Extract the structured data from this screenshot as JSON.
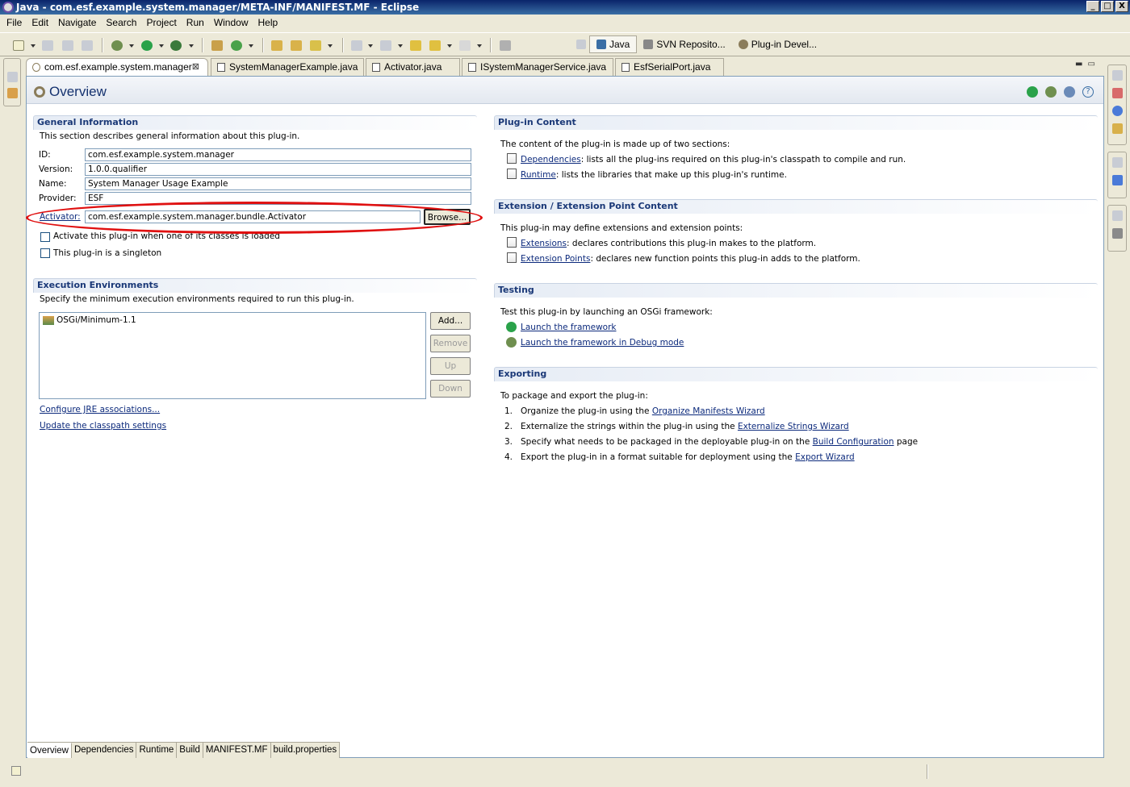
{
  "window": {
    "title": "Java - com.esf.example.system.manager/META-INF/MANIFEST.MF - Eclipse",
    "min": "_",
    "max": "□",
    "close": "X"
  },
  "menu": [
    "File",
    "Edit",
    "Navigate",
    "Search",
    "Project",
    "Run",
    "Window",
    "Help"
  ],
  "perspectives": [
    {
      "label": "Java",
      "active": true
    },
    {
      "label": "SVN Reposito...",
      "active": false
    },
    {
      "label": "Plug-in Devel...",
      "active": false
    }
  ],
  "editor_tabs": [
    {
      "label": "com.esf.example.system.manager",
      "active": true
    },
    {
      "label": "SystemManagerExample.java",
      "active": false
    },
    {
      "label": "Activator.java",
      "active": false
    },
    {
      "label": "ISystemManagerService.java",
      "active": false
    },
    {
      "label": "EsfSerialPort.java",
      "active": false
    }
  ],
  "form": {
    "title": "Overview",
    "general": {
      "title": "General Information",
      "desc": "This section describes general information about this plug-in.",
      "id_label": "ID:",
      "id_value": "com.esf.example.system.manager",
      "version_label": "Version:",
      "version_value": "1.0.0.qualifier",
      "name_label": "Name:",
      "name_value": "System Manager Usage Example",
      "provider_label": "Provider:",
      "provider_value": "ESF",
      "activator_label": "Activator:",
      "activator_value": "com.esf.example.system.manager.bundle.Activator",
      "browse_label": "Browse...",
      "activate_checkbox": "Activate this plug-in when one of its classes is loaded",
      "singleton_checkbox": "This plug-in is a singleton"
    },
    "exec_env": {
      "title": "Execution Environments",
      "desc": "Specify the minimum execution environments required to run this plug-in.",
      "items": [
        "OSGi/Minimum-1.1"
      ],
      "add_label": "Add...",
      "remove_label": "Remove",
      "up_label": "Up",
      "down_label": "Down",
      "configure_link": "Configure JRE associations...",
      "update_link": "Update the classpath settings"
    },
    "content": {
      "title": "Plug-in Content",
      "desc": "The content of the plug-in is made up of two sections:",
      "dep_link": "Dependencies",
      "dep_text": ": lists all the plug-ins required on this plug-in's classpath to compile and run.",
      "rt_link": "Runtime",
      "rt_text": ": lists the libraries that make up this plug-in's runtime."
    },
    "extension": {
      "title": "Extension / Extension Point Content",
      "desc": "This plug-in may define extensions and extension points:",
      "ext_link": "Extensions",
      "ext_text": ": declares contributions this plug-in makes to the platform.",
      "pt_link": "Extension Points",
      "pt_text": ": declares new function points this plug-in adds to the platform."
    },
    "testing": {
      "title": "Testing",
      "desc": "Test this plug-in by launching an OSGi framework:",
      "launch_link": "Launch the framework",
      "debug_link": "Launch the framework in Debug mode"
    },
    "exporting": {
      "title": "Exporting",
      "desc": "To package and export the plug-in:",
      "steps": [
        {
          "num": "1.",
          "text": "Organize the plug-in using the ",
          "link": "Organize Manifests Wizard",
          "after": ""
        },
        {
          "num": "2.",
          "text": "Externalize the strings within the plug-in using the ",
          "link": "Externalize Strings Wizard",
          "after": ""
        },
        {
          "num": "3.",
          "text": "Specify what needs to be packaged in the deployable plug-in on the ",
          "link": "Build Configuration",
          "after": " page"
        },
        {
          "num": "4.",
          "text": "Export the plug-in in a format suitable for deployment using the ",
          "link": "Export Wizard",
          "after": ""
        }
      ]
    }
  },
  "bottom_tabs": [
    "Overview",
    "Dependencies",
    "Runtime",
    "Build",
    "MANIFEST.MF",
    "build.properties"
  ]
}
